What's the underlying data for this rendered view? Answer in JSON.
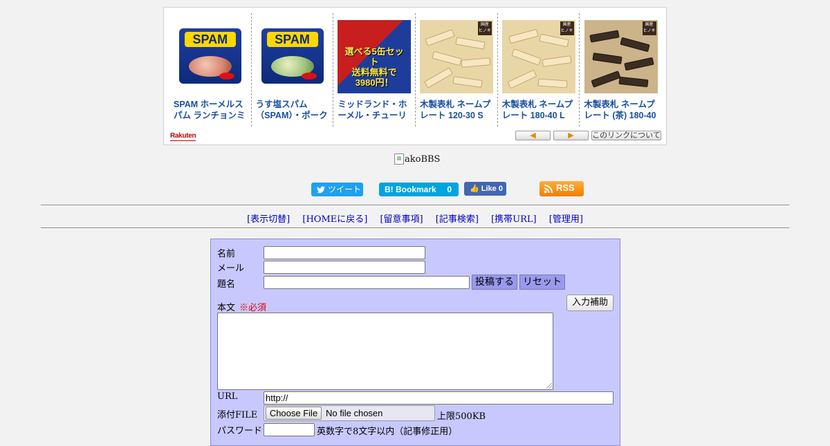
{
  "carousel": {
    "items": [
      {
        "title": "SPAM ホーメルスパム ランチョンミ",
        "thumb_label": "SPAM"
      },
      {
        "title": "うす塩スパム（SPAM）・ポークラン",
        "thumb_label": "SPAM"
      },
      {
        "title": "ミッドランド・ホーメル・チューリ",
        "thumb_overlay": "選べる5缶セット\n送料無料で\n3980円！"
      },
      {
        "title": "木製表札 ネームプレート 120-30 S",
        "thumb_tag": "国産\nヒノキ"
      },
      {
        "title": "木製表札 ネームプレート 180-40 L",
        "thumb_tag": "国産\nヒノキ"
      },
      {
        "title": "木製表札 ネームプレート (茶) 180-40",
        "thumb_tag": "国産\nヒノキ"
      }
    ],
    "logo": "Rakuten",
    "prev_label": "◀",
    "next_label": "▶",
    "about_label": "このリンクについて"
  },
  "bbs_logo_alt": "akoBBS",
  "share": {
    "tweet": "ツイート",
    "hatena": "Bookmark",
    "hatena_count": "0",
    "fb_like": "Like",
    "fb_count": "0",
    "rss": "RSS"
  },
  "menu": [
    "[表示切替]",
    "[HOMEに戻る]",
    "[留意事項]",
    "[記事検索]",
    "[携帯URL]",
    "[管理用]"
  ],
  "form": {
    "name_label": "名前",
    "mail_label": "メール",
    "subject_label": "題名",
    "post_button": "投稿する",
    "reset_button": "リセット",
    "body_label": "本文",
    "required": "※必須",
    "help_button": "入力補助",
    "url_label": "URL",
    "url_value": "http://",
    "file_label": "添付FILE",
    "file_button": "Choose File",
    "file_status": "No file chosen",
    "file_limit": "上限500KB",
    "password_label": "パスワード",
    "password_note": "英数字で8文字以内（記事修正用）"
  },
  "colors": {
    "link": "#1a4ea0",
    "menu_link": "#0000c0",
    "form_bg": "#c8c8ff",
    "required": "#e00000"
  }
}
